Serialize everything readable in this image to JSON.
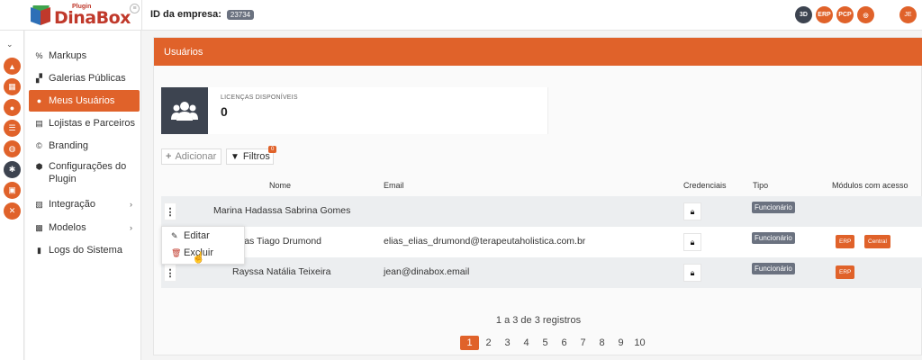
{
  "app": {
    "logo_small": "Plugin",
    "logo_big": "DinaBox",
    "company_label": "ID da empresa:",
    "company_id": "23734"
  },
  "top_icons": [
    {
      "label": "3D",
      "style": "dark"
    },
    {
      "label": "ERP",
      "style": "orange"
    },
    {
      "label": "PCP",
      "style": "orange"
    },
    {
      "label": "◎",
      "style": "orange"
    }
  ],
  "user_initials": "JE",
  "sidebar": {
    "items": [
      {
        "label": "Markups",
        "icon": "percent-icon"
      },
      {
        "label": "Galerias Públicas",
        "icon": "gallery-icon"
      },
      {
        "label": "Meus Usuários",
        "icon": "users-icon",
        "active": true
      },
      {
        "label": "Lojistas e Parceiros",
        "icon": "store-icon"
      },
      {
        "label": "Branding",
        "icon": "copyright-icon"
      },
      {
        "label": "Configurações do Plugin",
        "icon": "cube-icon"
      },
      {
        "label": "Integração",
        "icon": "integration-icon",
        "submenu": true
      },
      {
        "label": "Modelos",
        "icon": "template-icon",
        "submenu": true
      },
      {
        "label": "Logs do Sistema",
        "icon": "logs-icon"
      }
    ]
  },
  "main": {
    "title": "Usuários",
    "license_label": "LICENÇAS DISPONÍVEIS",
    "license_value": "0",
    "add_button": "Adicionar",
    "filter_button": "Filtros",
    "filter_count": "0",
    "columns": [
      "Nome",
      "Email",
      "Credenciais",
      "Tipo",
      "Módulos com acesso"
    ],
    "rows": [
      {
        "name": "Marina Hadassa Sabrina Gomes",
        "email": "",
        "tipo": "Funcionário",
        "modules": []
      },
      {
        "name": "as Tiago Drumond",
        "email": "elias_elias_drumond@terapeutaholistica.com.br",
        "tipo": "Funcionário",
        "modules": [
          "ERP",
          "Central"
        ]
      },
      {
        "name": "Rayssa Natália Teixeira",
        "email": "jean@dinabox.email",
        "tipo": "Funcionário",
        "modules": [
          "ERP"
        ]
      }
    ],
    "menu": {
      "edit": "Editar",
      "delete": "Excluir"
    },
    "records": "1 a 3 de 3 registros",
    "pages": [
      "1",
      "2",
      "3",
      "4",
      "5",
      "6",
      "7",
      "8",
      "9",
      "10"
    ]
  },
  "colors": {
    "accent": "#e0622a",
    "dark": "#3d4450",
    "badge": "#6b7280"
  }
}
